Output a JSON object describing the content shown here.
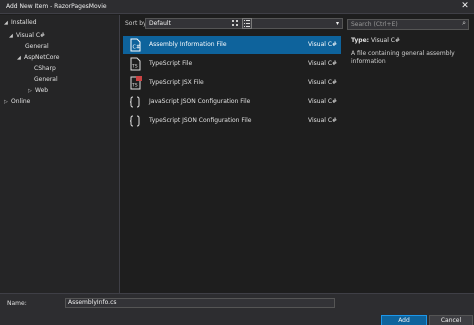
{
  "window": {
    "title": "Add New Item - RazorPagesMovie",
    "close_glyph": "✕"
  },
  "tree": [
    {
      "label": "Installed",
      "expanded": true
    },
    {
      "label": "Visual C#",
      "expanded": true,
      "selected": true
    },
    {
      "label": "General"
    },
    {
      "label": "AspNetCore",
      "expanded": true
    },
    {
      "label": "CSharp"
    },
    {
      "label": "General"
    },
    {
      "label": "Web",
      "expanded": false
    },
    {
      "label": "Online",
      "expanded": false
    }
  ],
  "toolbar": {
    "sort_label": "Sort by:",
    "sort_value": "Default"
  },
  "search": {
    "placeholder": "Search (Ctrl+E)",
    "icon": "search-icon"
  },
  "items": [
    {
      "name": "Assembly Information File",
      "lang": "Visual C#",
      "icon": "cs-file-icon",
      "selected": true
    },
    {
      "name": "TypeScript File",
      "lang": "Visual C#",
      "icon": "ts-file-icon"
    },
    {
      "name": "TypeScript JSX File",
      "lang": "Visual C#",
      "icon": "tsx-file-icon"
    },
    {
      "name": "JavaScript JSON Configuration File",
      "lang": "Visual C#",
      "icon": "json-config-icon"
    },
    {
      "name": "TypeScript JSON Configuration File",
      "lang": "Visual C#",
      "icon": "json-config-icon"
    }
  ],
  "details": {
    "type_label": "Type:",
    "type_value": "Visual C#",
    "description": "A file containing general assembly information"
  },
  "bottom": {
    "name_label": "Name:",
    "name_value": "AssemblyInfo.cs",
    "add_label": "Add",
    "cancel_label": "Cancel"
  },
  "colors": {
    "accent": "#0e639c",
    "background": "#1e1e1e",
    "panel": "#252526"
  }
}
